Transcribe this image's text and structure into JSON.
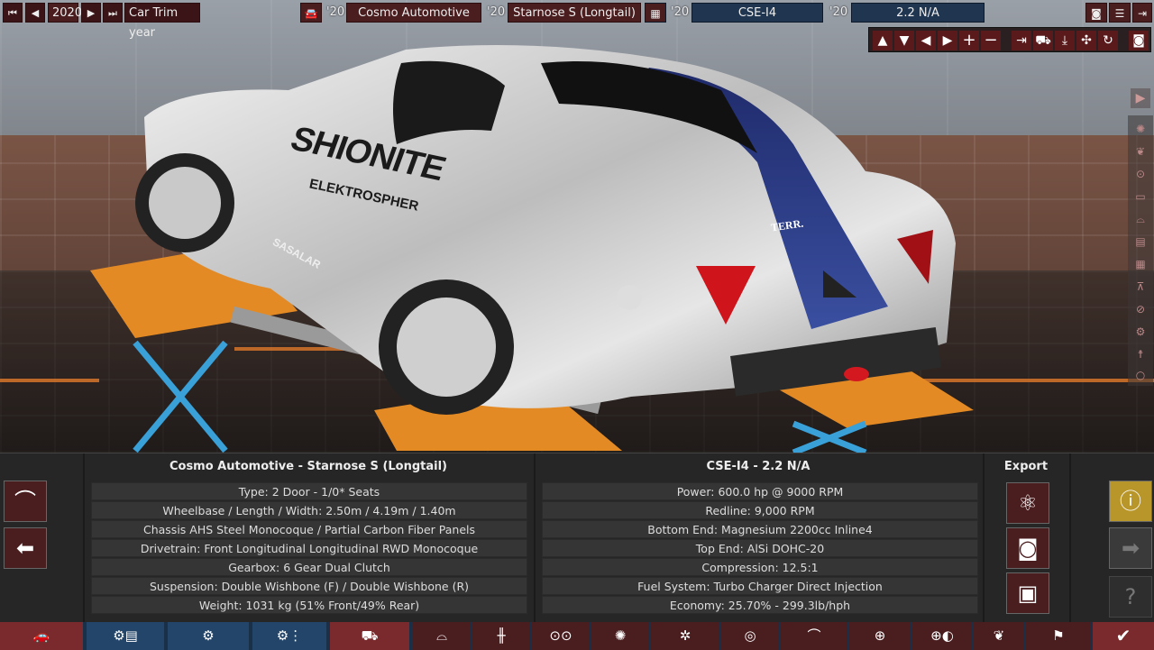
{
  "topbar": {
    "year": "2020",
    "trim_label": "Car Trim year",
    "model_year_1": "'20",
    "company": "Cosmo Automotive",
    "model_year_2": "'20",
    "model": "Starnose S (Longtail)",
    "engine_year_1": "'20",
    "engine_family": "CSE-I4",
    "engine_year_2": "'20",
    "engine_variant": "2.2 N/A"
  },
  "panel": {
    "car_title": "Cosmo Automotive - Starnose S (Longtail)",
    "engine_title": "CSE-I4 - 2.2 N/A",
    "export_title": "Export",
    "car_rows": [
      "Type: 2 Door - 1/0* Seats",
      "Wheelbase / Length / Width: 2.50m / 4.19m / 1.40m",
      "Chassis AHS Steel Monocoque / Partial Carbon Fiber Panels",
      "Drivetrain: Front Longitudinal Longitudinal RWD Monocoque",
      "Gearbox: 6 Gear Dual Clutch",
      "Suspension: Double Wishbone (F) / Double Wishbone (R)",
      "Weight: 1031 kg (51% Front/49% Rear)"
    ],
    "engine_rows": [
      "Power: 600.0 hp @ 9000 RPM",
      "Redline:  9,000 RPM",
      "Bottom End: Magnesium 2200cc Inline4",
      "Top End: AlSi DOHC-20",
      "Compression: 12.5:1",
      "Fuel System: Turbo Charger Direct Injection",
      "Economy: 25.70% - 299.3lb/hph"
    ]
  },
  "scene": {
    "livery_main": "SHIONITE",
    "livery_sub": "ELEKTROSPHER",
    "side_text": "SASALAR",
    "rear_badge": "TERR."
  },
  "colors": {
    "accent": "#4a1d1f",
    "nav_blue": "#1f3550",
    "nav_red": "#7a2a2c",
    "warn_yellow": "#b8962a"
  }
}
